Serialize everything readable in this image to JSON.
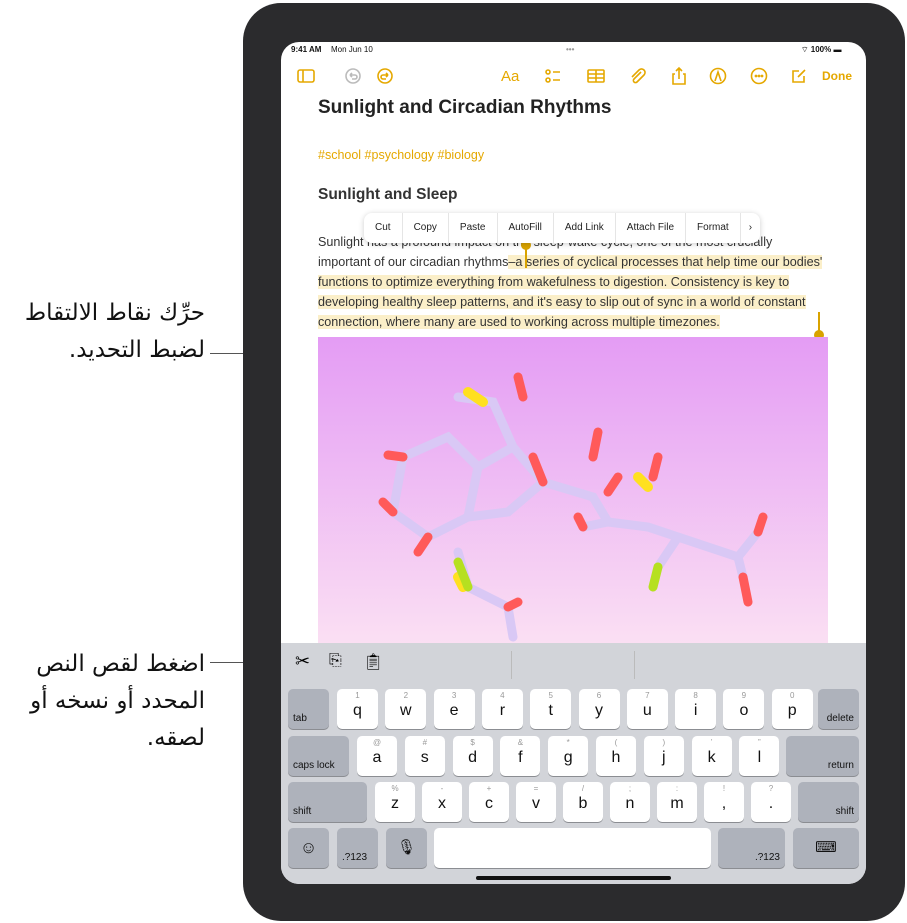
{
  "callouts": {
    "handles": "حرِّك نقاط الالتقاط لضبط التحديد.",
    "cut": "اضغط لقص النص المحدد أو نسخه أو لصقه."
  },
  "status": {
    "time": "9:41 AM",
    "date": "Mon Jun 10",
    "battery": "100%"
  },
  "toolbar": {
    "format": "Aa",
    "done": "Done"
  },
  "note": {
    "title": "Sunlight and Circadian Rhythms",
    "tags": "#school #psychology #biology",
    "heading": "Sunlight and Sleep",
    "line1": "Sunlight has a profound impact on the sleep-wake cycle, one of the most crucially",
    "pre": "important of our circadian rhythms",
    "selected": "–a series of cyclical processes that help time our bodies' functions to optimize everything from wakefulness to digestion. Consistency is key to developing healthy sleep patterns, and it's easy to slip out of sync in a world of constant connection, where many are used to working across multiple timezones."
  },
  "menu": [
    "Cut",
    "Copy",
    "Paste",
    "AutoFill",
    "Add Link",
    "Attach File",
    "Format",
    "›"
  ],
  "keyboard": {
    "row1": [
      [
        "1",
        "q"
      ],
      [
        "2",
        "w"
      ],
      [
        "3",
        "e"
      ],
      [
        "4",
        "r"
      ],
      [
        "5",
        "t"
      ],
      [
        "6",
        "y"
      ],
      [
        "7",
        "u"
      ],
      [
        "8",
        "i"
      ],
      [
        "9",
        "o"
      ],
      [
        "0",
        "p"
      ]
    ],
    "row2": [
      [
        "@",
        "a"
      ],
      [
        "#",
        "s"
      ],
      [
        "$",
        "d"
      ],
      [
        "&",
        "f"
      ],
      [
        "*",
        "g"
      ],
      [
        "(",
        "h"
      ],
      [
        ")",
        "j"
      ],
      [
        "’",
        "k"
      ],
      [
        "”",
        "l"
      ]
    ],
    "row3": [
      [
        "%",
        "z"
      ],
      [
        "-",
        "x"
      ],
      [
        "+",
        "c"
      ],
      [
        "=",
        "v"
      ],
      [
        "/",
        "b"
      ],
      [
        ";",
        "n"
      ],
      [
        ":",
        "m"
      ],
      [
        "!",
        ","
      ],
      [
        "?",
        "."
      ]
    ],
    "tab": "tab",
    "delete": "delete",
    "caps": "caps lock",
    "return": "return",
    "shift": "shift",
    "num": ".?123"
  }
}
